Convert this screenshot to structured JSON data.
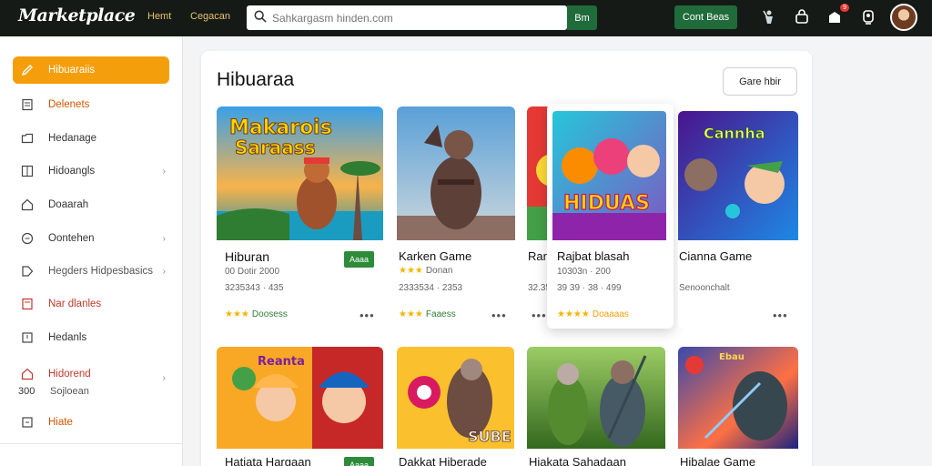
{
  "header": {
    "logo": "Marketplace",
    "nav": [
      "Hemt",
      "Cegacan"
    ],
    "search_placeholder": "Sahkargasm hinden.com",
    "search_button": "Bm",
    "cta_button": "Cont Beas",
    "notification_count": "9"
  },
  "sidebar": {
    "items": [
      {
        "label": "Hibuaraiis",
        "icon": "pencil-icon",
        "color": "#ffffff"
      },
      {
        "label": "Delenets",
        "icon": "document-icon",
        "color": "#c0392b"
      },
      {
        "label": "Hedanage",
        "icon": "folder-icon",
        "color": "#333333"
      },
      {
        "label": "Hidoangls",
        "icon": "grid-icon",
        "color": "#333333",
        "chevron": "›"
      },
      {
        "label": "Doaarah",
        "icon": "home-icon",
        "color": "#333333"
      },
      {
        "label": "Oontehen",
        "icon": "clock-icon",
        "color": "#333333",
        "chevron": "›"
      },
      {
        "label": "Hegders Hidpesbasics",
        "icon": "tag-icon",
        "color": "#8e44ad",
        "chevron": "›"
      },
      {
        "label": "Nar dlanles",
        "icon": "list-icon",
        "color": "#c0392b"
      },
      {
        "label": "Hedanls",
        "icon": "box-icon",
        "color": "#333333"
      },
      {
        "label": "Hidorend",
        "icon": "home-icon",
        "color": "#c0392b",
        "chevron": "›"
      },
      {
        "label": "Hiate",
        "icon": "file-icon",
        "color": "#d35400"
      }
    ],
    "sub_number": "300",
    "sub_label": "Sojloean"
  },
  "main": {
    "title": "Hibuaraa",
    "button": "Gare hbir",
    "cards": [
      {
        "title": "Hiburan",
        "meta1": "00 Dotir 2000",
        "meta2": "3235343 · 435",
        "stars": "★★★",
        "star_label": "Doosess",
        "badge": "Aaaa"
      },
      {
        "title": "Karken Game",
        "meta1": "Donan",
        "meta2": "2333534 · 2353",
        "stars": "★★★",
        "star_label": "Faaess"
      },
      {
        "title": "Rar",
        "meta1": "",
        "meta2": "32.35",
        "stars": "",
        "star_label": ""
      },
      {
        "title": "Rajbat blasah",
        "meta1": "10303n · 200",
        "meta2": "39 39 · 38 · 499",
        "stars": "★★★★",
        "star_label": "Doaaaas"
      },
      {
        "title": "Cianna Game",
        "meta1": "",
        "meta2": "Senoonchalt",
        "stars": "",
        "star_label": ""
      },
      {
        "title": "Hatiata Hargaan",
        "badge": "Aaaa"
      },
      {
        "title": "Dakkat Hiberade"
      },
      {
        "title": "Hiakata Sahadaan"
      },
      {
        "title": "Hibalae Game"
      }
    ],
    "thumb_labels": {
      "c1": "Makarois",
      "c1b": "Saraass",
      "c4": "HIDUAS",
      "c5": "Cannha",
      "c6": "Reanta",
      "c7": "SUBE",
      "c9": "Ebau"
    }
  }
}
